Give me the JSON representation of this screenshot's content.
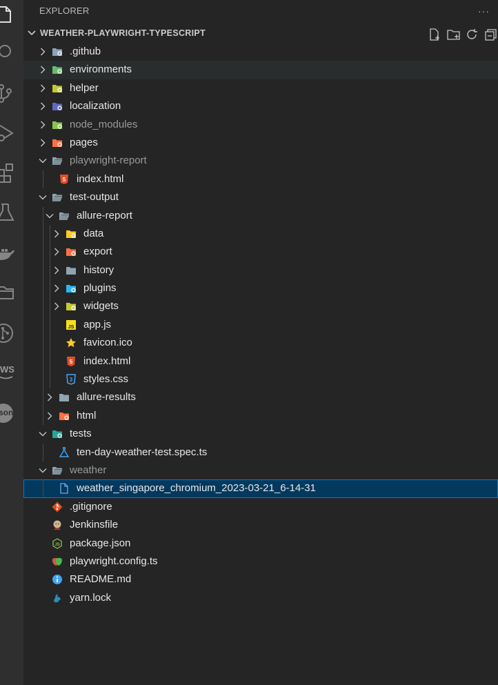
{
  "explorer": {
    "title": "EXPLORER",
    "more_actions": "···"
  },
  "section": {
    "title": "WEATHER-PLAYWRIGHT-TYPESCRIPT",
    "actions": [
      "new-file-icon",
      "new-folder-icon",
      "refresh-icon",
      "collapse-all-icon"
    ]
  },
  "activity_bar": {
    "items": [
      "explorer-icon",
      "search-icon",
      "source-control-icon",
      "run-debug-icon",
      "extensions-icon",
      "testing-icon",
      "docker-icon",
      "folder-icon",
      "git-graph-icon",
      "aws-icon",
      "json-icon"
    ],
    "aws_label": "WS",
    "json_label": "son"
  },
  "tree": [
    {
      "label": ".github",
      "type": "folder",
      "depth": 0,
      "expanded": false,
      "icon": "github-folder-icon",
      "color": "#8aa4b8"
    },
    {
      "label": "environments",
      "type": "folder",
      "depth": 0,
      "expanded": false,
      "icon": "environment-folder-icon",
      "color": "#66bb6a"
    },
    {
      "label": "helper",
      "type": "folder",
      "depth": 0,
      "expanded": false,
      "icon": "helper-folder-icon",
      "color": "#c0ca33"
    },
    {
      "label": "localization",
      "type": "folder",
      "depth": 0,
      "expanded": false,
      "icon": "i18n-folder-icon",
      "color": "#5c6bc0"
    },
    {
      "label": "node_modules",
      "type": "folder",
      "depth": 0,
      "expanded": false,
      "dim": true,
      "icon": "node-folder-icon",
      "color": "#8bc34a"
    },
    {
      "label": "pages",
      "type": "folder",
      "depth": 0,
      "expanded": false,
      "icon": "pages-folder-icon",
      "color": "#ff7043"
    },
    {
      "label": "playwright-report",
      "type": "folder",
      "depth": 0,
      "expanded": true,
      "dim": true,
      "icon": "open-folder-icon",
      "color": "#90a4ae"
    },
    {
      "label": "index.html",
      "type": "file",
      "depth": 1,
      "icon": "html-file-icon",
      "color": "#e44d26"
    },
    {
      "label": "test-output",
      "type": "folder",
      "depth": 0,
      "expanded": true,
      "icon": "open-folder-icon",
      "color": "#90a4ae"
    },
    {
      "label": "allure-report",
      "type": "folder",
      "depth": 1,
      "expanded": true,
      "icon": "open-folder-icon",
      "color": "#90a4ae"
    },
    {
      "label": "data",
      "type": "folder",
      "depth": 2,
      "expanded": false,
      "icon": "database-folder-icon",
      "color": "#ffca28"
    },
    {
      "label": "export",
      "type": "folder",
      "depth": 2,
      "expanded": false,
      "icon": "export-folder-icon",
      "color": "#ff7043"
    },
    {
      "label": "history",
      "type": "folder",
      "depth": 2,
      "expanded": false,
      "icon": "folder-icon",
      "color": "#90a4ae"
    },
    {
      "label": "plugins",
      "type": "folder",
      "depth": 2,
      "expanded": false,
      "icon": "plugin-folder-icon",
      "color": "#29b6f6"
    },
    {
      "label": "widgets",
      "type": "folder",
      "depth": 2,
      "expanded": false,
      "icon": "widgets-folder-icon",
      "color": "#c0ca33"
    },
    {
      "label": "app.js",
      "type": "file",
      "depth": 2,
      "icon": "javascript-file-icon",
      "color": "#f7df1e"
    },
    {
      "label": "favicon.ico",
      "type": "file",
      "depth": 2,
      "icon": "star-icon",
      "color": "#ffca28"
    },
    {
      "label": "index.html",
      "type": "file",
      "depth": 2,
      "icon": "html-file-icon",
      "color": "#e44d26"
    },
    {
      "label": "styles.css",
      "type": "file",
      "depth": 2,
      "icon": "css-file-icon",
      "color": "#42a5f5"
    },
    {
      "label": "allure-results",
      "type": "folder",
      "depth": 1,
      "expanded": false,
      "icon": "folder-icon",
      "color": "#90a4ae"
    },
    {
      "label": "html",
      "type": "folder",
      "depth": 1,
      "expanded": false,
      "icon": "html-folder-icon",
      "color": "#ff7043"
    },
    {
      "label": "tests",
      "type": "folder",
      "depth": 0,
      "expanded": true,
      "icon": "test-folder-icon",
      "color": "#26a69a"
    },
    {
      "label": "ten-day-weather-test.spec.ts",
      "type": "file",
      "depth": 1,
      "icon": "test-flask-icon",
      "color": "#42a5f5"
    },
    {
      "label": "weather",
      "type": "folder",
      "depth": 0,
      "expanded": true,
      "dim": true,
      "icon": "open-folder-icon",
      "color": "#90a4ae"
    },
    {
      "label": "weather_singapore_chromium_2023-03-21_6-14-31",
      "type": "file",
      "depth": 1,
      "selected": true,
      "icon": "file-icon",
      "color": "#6fa8dc"
    },
    {
      "label": ".gitignore",
      "type": "file",
      "depth": 0,
      "icon": "git-icon",
      "color": "#e64a19"
    },
    {
      "label": "Jenkinsfile",
      "type": "file",
      "depth": 0,
      "icon": "jenkins-icon",
      "color": "#d1b48c"
    },
    {
      "label": "package.json",
      "type": "file",
      "depth": 0,
      "icon": "nodejs-icon",
      "color": "#8bc34a"
    },
    {
      "label": "playwright.config.ts",
      "type": "file",
      "depth": 0,
      "icon": "playwright-icon",
      "color": "#45ba4b"
    },
    {
      "label": "README.md",
      "type": "file",
      "depth": 0,
      "icon": "info-icon",
      "color": "#42a5f5"
    },
    {
      "label": "yarn.lock",
      "type": "file",
      "depth": 0,
      "icon": "yarn-icon",
      "color": "#2c8ebb"
    }
  ]
}
